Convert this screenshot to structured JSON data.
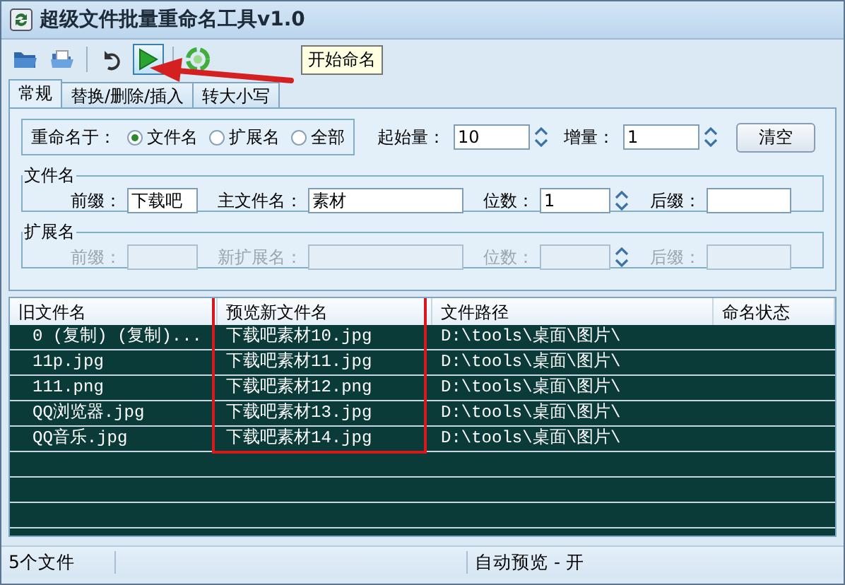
{
  "window": {
    "title": "超级文件批量重命名工具v1.0"
  },
  "toolbar": {
    "tooltip": "开始命名"
  },
  "tabs": [
    {
      "label": "常规",
      "selected": true
    },
    {
      "label": "替换/删除/插入",
      "selected": false
    },
    {
      "label": "转大小写",
      "selected": false
    }
  ],
  "rename_target": {
    "label": "重命名于：",
    "options": [
      {
        "label": "文件名",
        "selected": true
      },
      {
        "label": "扩展名",
        "selected": false
      },
      {
        "label": "全部",
        "selected": false
      }
    ]
  },
  "start": {
    "label": "起始量：",
    "value": "10"
  },
  "step": {
    "label": "增量：",
    "value": "1"
  },
  "clear_button": "清空",
  "filename_group": {
    "title": "文件名",
    "disabled": false,
    "fields": [
      {
        "label": "前缀：",
        "value": "下载吧"
      },
      {
        "label": "主文件名：",
        "value": "素材"
      },
      {
        "label": "位数：",
        "value": "1",
        "kind": "spin"
      },
      {
        "label": "后缀：",
        "kind": "text"
      }
    ]
  },
  "extension_group": {
    "title": "扩展名",
    "disabled": true,
    "fields": [
      {
        "label": "前缀：",
        "kind": "text"
      },
      {
        "label": "新扩展名：",
        "kind": "text"
      },
      {
        "label": "位数：",
        "kind": "spin"
      },
      {
        "label": "后缀：",
        "kind": "text"
      }
    ]
  },
  "table": {
    "columns": [
      "旧文件名",
      "预览新文件名",
      "文件路径",
      "命名状态"
    ],
    "rows": [
      {
        "cells": [
          "0 (复制) (复制)...",
          "下载吧素材10.jpg",
          "D:\\tools\\桌面\\图片\\"
        ]
      },
      {
        "cells": [
          "11p.jpg",
          "下载吧素材11.jpg",
          "D:\\tools\\桌面\\图片\\"
        ]
      },
      {
        "cells": [
          "111.png",
          "下载吧素材12.png",
          "D:\\tools\\桌面\\图片\\"
        ]
      },
      {
        "cells": [
          "QQ浏览器.jpg",
          "下载吧素材13.jpg",
          "D:\\tools\\桌面\\图片\\"
        ]
      },
      {
        "cells": [
          "QQ音乐.jpg",
          "下载吧素材14.jpg",
          "D:\\tools\\桌面\\图片\\"
        ]
      }
    ]
  },
  "status_bar": {
    "file_count": "5个文件",
    "auto_preview": "自动预览 - 开"
  }
}
